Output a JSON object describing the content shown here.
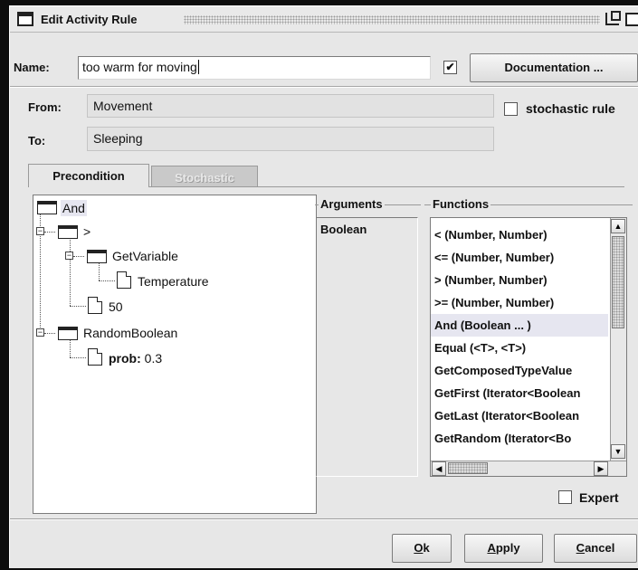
{
  "window": {
    "title": "Edit Activity Rule"
  },
  "name_row": {
    "label": "Name:",
    "value": "too warm for moving",
    "checkbox_mark": "✔",
    "documentation_label": "Documentation ..."
  },
  "transition": {
    "from_label": "From:",
    "from_value": "Movement",
    "to_label": "To:",
    "to_value": "Sleeping",
    "stochastic_label": "stochastic rule"
  },
  "tabs": [
    {
      "label": "Precondition",
      "active": true
    },
    {
      "label": "Stochastic",
      "active": false
    }
  ],
  "tree": {
    "nodes": [
      {
        "label": "And",
        "kind": "folder",
        "depth": 0
      },
      {
        "label": ">",
        "kind": "folder",
        "depth": 1
      },
      {
        "label": "GetVariable",
        "kind": "folder",
        "depth": 2
      },
      {
        "label": "Temperature",
        "kind": "leaf",
        "depth": 3
      },
      {
        "label": "50",
        "kind": "leaf",
        "depth": 2
      },
      {
        "label": "RandomBoolean",
        "kind": "folder",
        "depth": 1
      },
      {
        "label_bold": "prob:",
        "label": " 0.3",
        "kind": "leaf",
        "depth": 2
      }
    ]
  },
  "arguments": {
    "title": "Arguments",
    "items": [
      "Boolean"
    ]
  },
  "functions": {
    "title": "Functions",
    "items": [
      "< (Number, Number)",
      "<= (Number, Number)",
      "> (Number, Number)",
      ">= (Number, Number)",
      "And (Boolean ... )",
      "Equal (<T>, <T>)",
      "GetComposedTypeValue",
      "GetFirst (Iterator<Boolean",
      "GetLast (Iterator<Boolean",
      "GetRandom (Iterator<Bo"
    ],
    "selected_index": 4
  },
  "expert_label": "Expert",
  "footer": {
    "ok_label": "Ok",
    "ok_mnemonic": "O",
    "ok_rest": "k",
    "apply_mnemonic": "A",
    "apply_rest": "pply",
    "cancel_mnemonic": "C",
    "cancel_rest": "ancel"
  }
}
